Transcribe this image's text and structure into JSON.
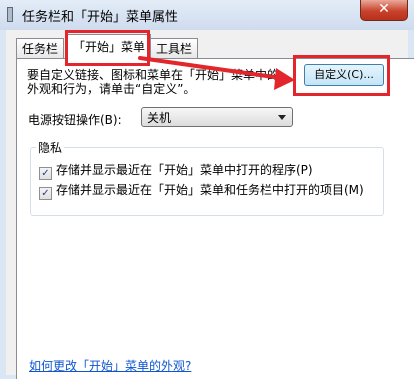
{
  "window": {
    "title": "任务栏和「开始」菜单属性",
    "close_glyph": "✕"
  },
  "tabs": [
    {
      "label": "任务栏",
      "active": false
    },
    {
      "label": "「开始」菜单",
      "active": true
    },
    {
      "label": "工具栏",
      "active": false
    }
  ],
  "start_menu": {
    "description_lines": [
      "要自定义链接、图标和菜单在「开始」菜单中的",
      "外观和行为，请单击“自定义”。"
    ],
    "customize_button": "自定义(C)...",
    "power_button_label": "电源按钮操作(B):",
    "power_button_value": "关机"
  },
  "privacy": {
    "legend": "隐私",
    "items": [
      {
        "label": "存储并显示最近在「开始」菜单中打开的程序(P)",
        "checked": true
      },
      {
        "label": "存储并显示最近在「开始」菜单和任务栏中打开的项目(M)",
        "checked": true
      }
    ],
    "check_glyph": "✓"
  },
  "help_link": "如何更改「开始」菜单的外观?",
  "colors": {
    "annotation_red": "#e2262b",
    "link_blue": "#0f56ce",
    "close_red": "#c8432c"
  }
}
